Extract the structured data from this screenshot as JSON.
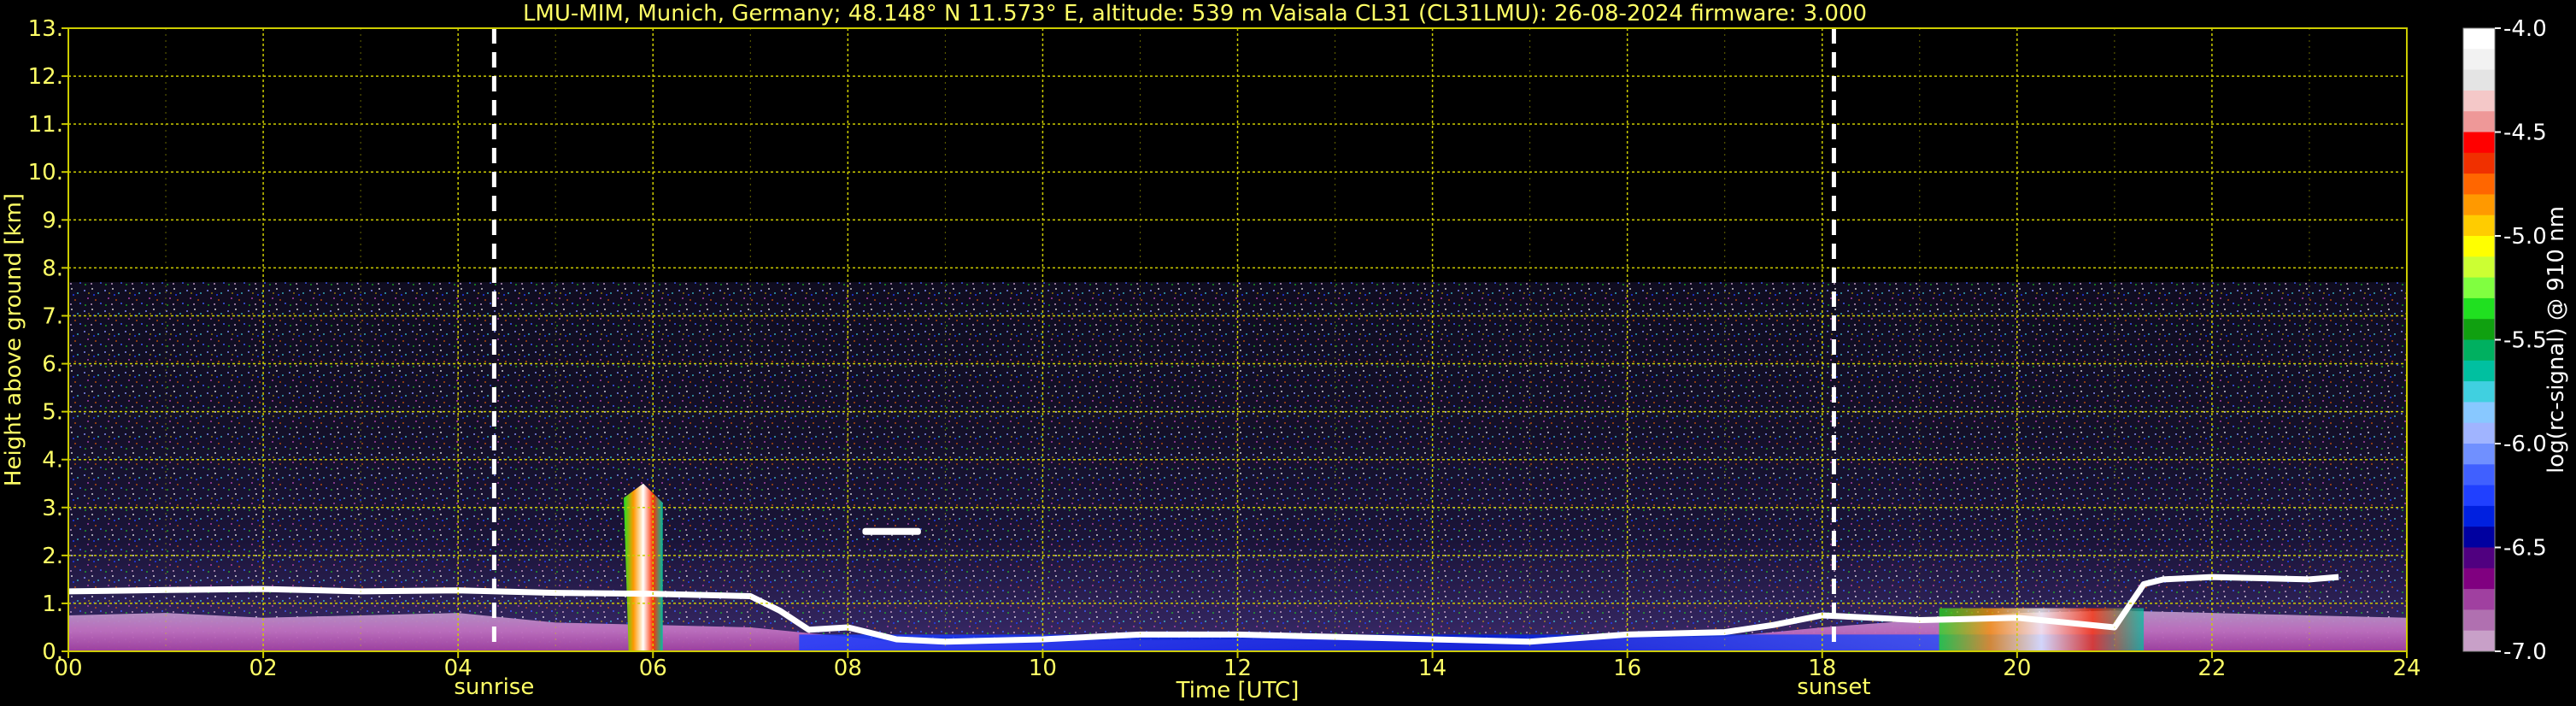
{
  "chart_data": {
    "type": "heatmap",
    "title": "LMU-MIM, Munich, Germany; 48.148° N 11.573° E, altitude: 539 m    Vaisala CL31 (CL31LMU): 26-08-2024    firmware: 3.000",
    "xlabel": "Time [UTC]",
    "ylabel": "Height above ground [km]",
    "xlim": [
      0,
      24
    ],
    "ylim": [
      0,
      13
    ],
    "x_ticks": [
      "00",
      "02",
      "04",
      "06",
      "08",
      "10",
      "12",
      "14",
      "16",
      "18",
      "20",
      "22",
      "24"
    ],
    "y_ticks": [
      "0.",
      "1.",
      "2.",
      "3.",
      "4.",
      "5.",
      "6.",
      "7.",
      "8.",
      "9.",
      "10.",
      "11.",
      "12.",
      "13."
    ],
    "grid": true,
    "markers": [
      {
        "label": "sunrise",
        "x": 4.37
      },
      {
        "label": "sunset",
        "x": 18.12
      }
    ],
    "colorbar": {
      "label": "log(rc-signal) @ 910 nm",
      "range": [
        -7.0,
        -4.0
      ],
      "ticks": [
        "-4.0",
        "-4.5",
        "-5.0",
        "-5.5",
        "-6.0",
        "-6.5",
        "-7.0"
      ],
      "colors": [
        "#ffffff",
        "#f2f2f2",
        "#e4e4e4",
        "#f4c8c8",
        "#ee9898",
        "#ff0000",
        "#f03000",
        "#ff6600",
        "#ff9900",
        "#ffcc00",
        "#ffff00",
        "#ccff33",
        "#80ff40",
        "#20e020",
        "#10a010",
        "#00b060",
        "#00c0a0",
        "#40d0e0",
        "#88c8ff",
        "#a0b4ff",
        "#7090ff",
        "#4060ff",
        "#2040ff",
        "#0020e0",
        "#0000a0",
        "#500080",
        "#800080",
        "#a040a0",
        "#b070b0",
        "#c8a0c8"
      ]
    },
    "data_extent_km": 7.7,
    "features": {
      "boundary_layer_line": [
        [
          0,
          1.25
        ],
        [
          1,
          1.28
        ],
        [
          2,
          1.3
        ],
        [
          3,
          1.25
        ],
        [
          4,
          1.27
        ],
        [
          5,
          1.22
        ],
        [
          6,
          1.2
        ],
        [
          7,
          1.15
        ],
        [
          7.3,
          0.85
        ],
        [
          7.6,
          0.45
        ],
        [
          8,
          0.5
        ],
        [
          8.5,
          0.25
        ],
        [
          9,
          0.2
        ],
        [
          10,
          0.25
        ],
        [
          11,
          0.35
        ],
        [
          12,
          0.35
        ],
        [
          13,
          0.3
        ],
        [
          14,
          0.25
        ],
        [
          15,
          0.2
        ],
        [
          16,
          0.35
        ],
        [
          17,
          0.4
        ],
        [
          17.5,
          0.55
        ],
        [
          18,
          0.75
        ],
        [
          19,
          0.65
        ],
        [
          20,
          0.7
        ],
        [
          21,
          0.5
        ],
        [
          21.3,
          1.4
        ],
        [
          21.5,
          1.5
        ],
        [
          22,
          1.55
        ],
        [
          23,
          1.5
        ],
        [
          23.3,
          1.55
        ]
      ],
      "surface_layer_top": [
        [
          0,
          0.75
        ],
        [
          1,
          0.8
        ],
        [
          2,
          0.7
        ],
        [
          3,
          0.75
        ],
        [
          4,
          0.8
        ],
        [
          5,
          0.6
        ],
        [
          6,
          0.55
        ],
        [
          7,
          0.5
        ],
        [
          7.5,
          0.4
        ],
        [
          8.5,
          0.2
        ],
        [
          12,
          0.25
        ],
        [
          17,
          0.3
        ],
        [
          18,
          0.5
        ],
        [
          20,
          0.8
        ],
        [
          21,
          0.85
        ],
        [
          22,
          0.8
        ],
        [
          23,
          0.75
        ],
        [
          24,
          0.7
        ]
      ],
      "convective_plume": {
        "x_range": [
          5.75,
          6.1
        ],
        "y_top": 3.5
      },
      "small_cloud": {
        "x_range": [
          8.15,
          8.75
        ],
        "y": 2.5
      }
    }
  }
}
